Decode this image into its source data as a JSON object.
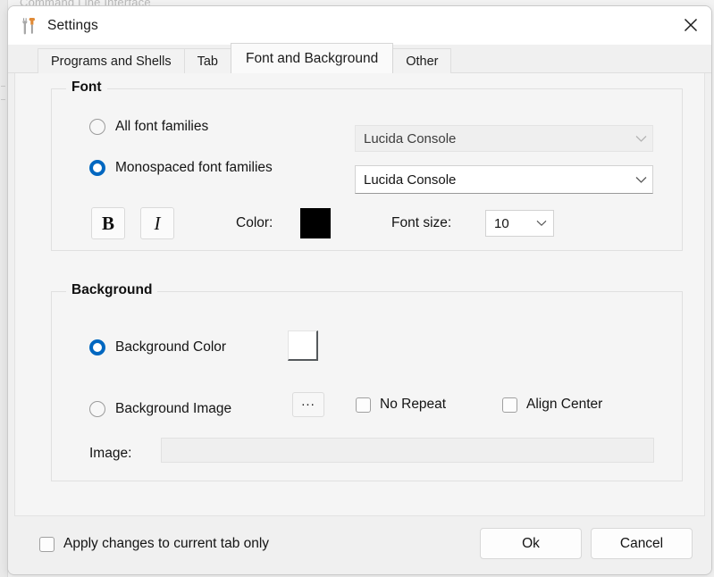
{
  "backdrop": {
    "window_title_fragment": "Command Line Interface"
  },
  "window": {
    "title": "Settings",
    "icon": "tools-icon",
    "close_label": "✕"
  },
  "tabs": [
    {
      "label": "Programs and Shells",
      "active": false
    },
    {
      "label": "Tab",
      "active": false
    },
    {
      "label": "Font and Background",
      "active": true
    },
    {
      "label": "Other",
      "active": false
    }
  ],
  "font_group": {
    "title": "Font",
    "all_fonts": {
      "radio_label": "All font families",
      "selected": false,
      "combo_value": "Lucida Console",
      "enabled": false
    },
    "mono_fonts": {
      "radio_label": "Monospaced font families",
      "selected": true,
      "combo_value": "Lucida Console",
      "enabled": true
    },
    "bold_label": "B",
    "italic_label": "I",
    "color_label": "Color:",
    "color_value": "#000000",
    "font_size_label": "Font size:",
    "font_size_value": "10"
  },
  "background_group": {
    "title": "Background",
    "background_color": {
      "radio_label": "Background Color",
      "selected": true,
      "color_value": "#ffffff"
    },
    "background_image": {
      "radio_label": "Background Image",
      "selected": false,
      "browse_label": "...",
      "no_repeat_label": "No Repeat",
      "no_repeat_checked": false,
      "align_center_label": "Align Center",
      "align_center_checked": false
    },
    "image_label": "Image:",
    "image_value": "",
    "image_enabled": false
  },
  "footer": {
    "apply_label": "Apply changes to current tab only",
    "apply_checked": false,
    "ok_label": "Ok",
    "cancel_label": "Cancel"
  },
  "colors": {
    "accent": "#0067c0",
    "dialog_bg": "#f0f0f0",
    "panel_bg": "#f5f5f5",
    "titlebar_bg": "#ffffff"
  }
}
